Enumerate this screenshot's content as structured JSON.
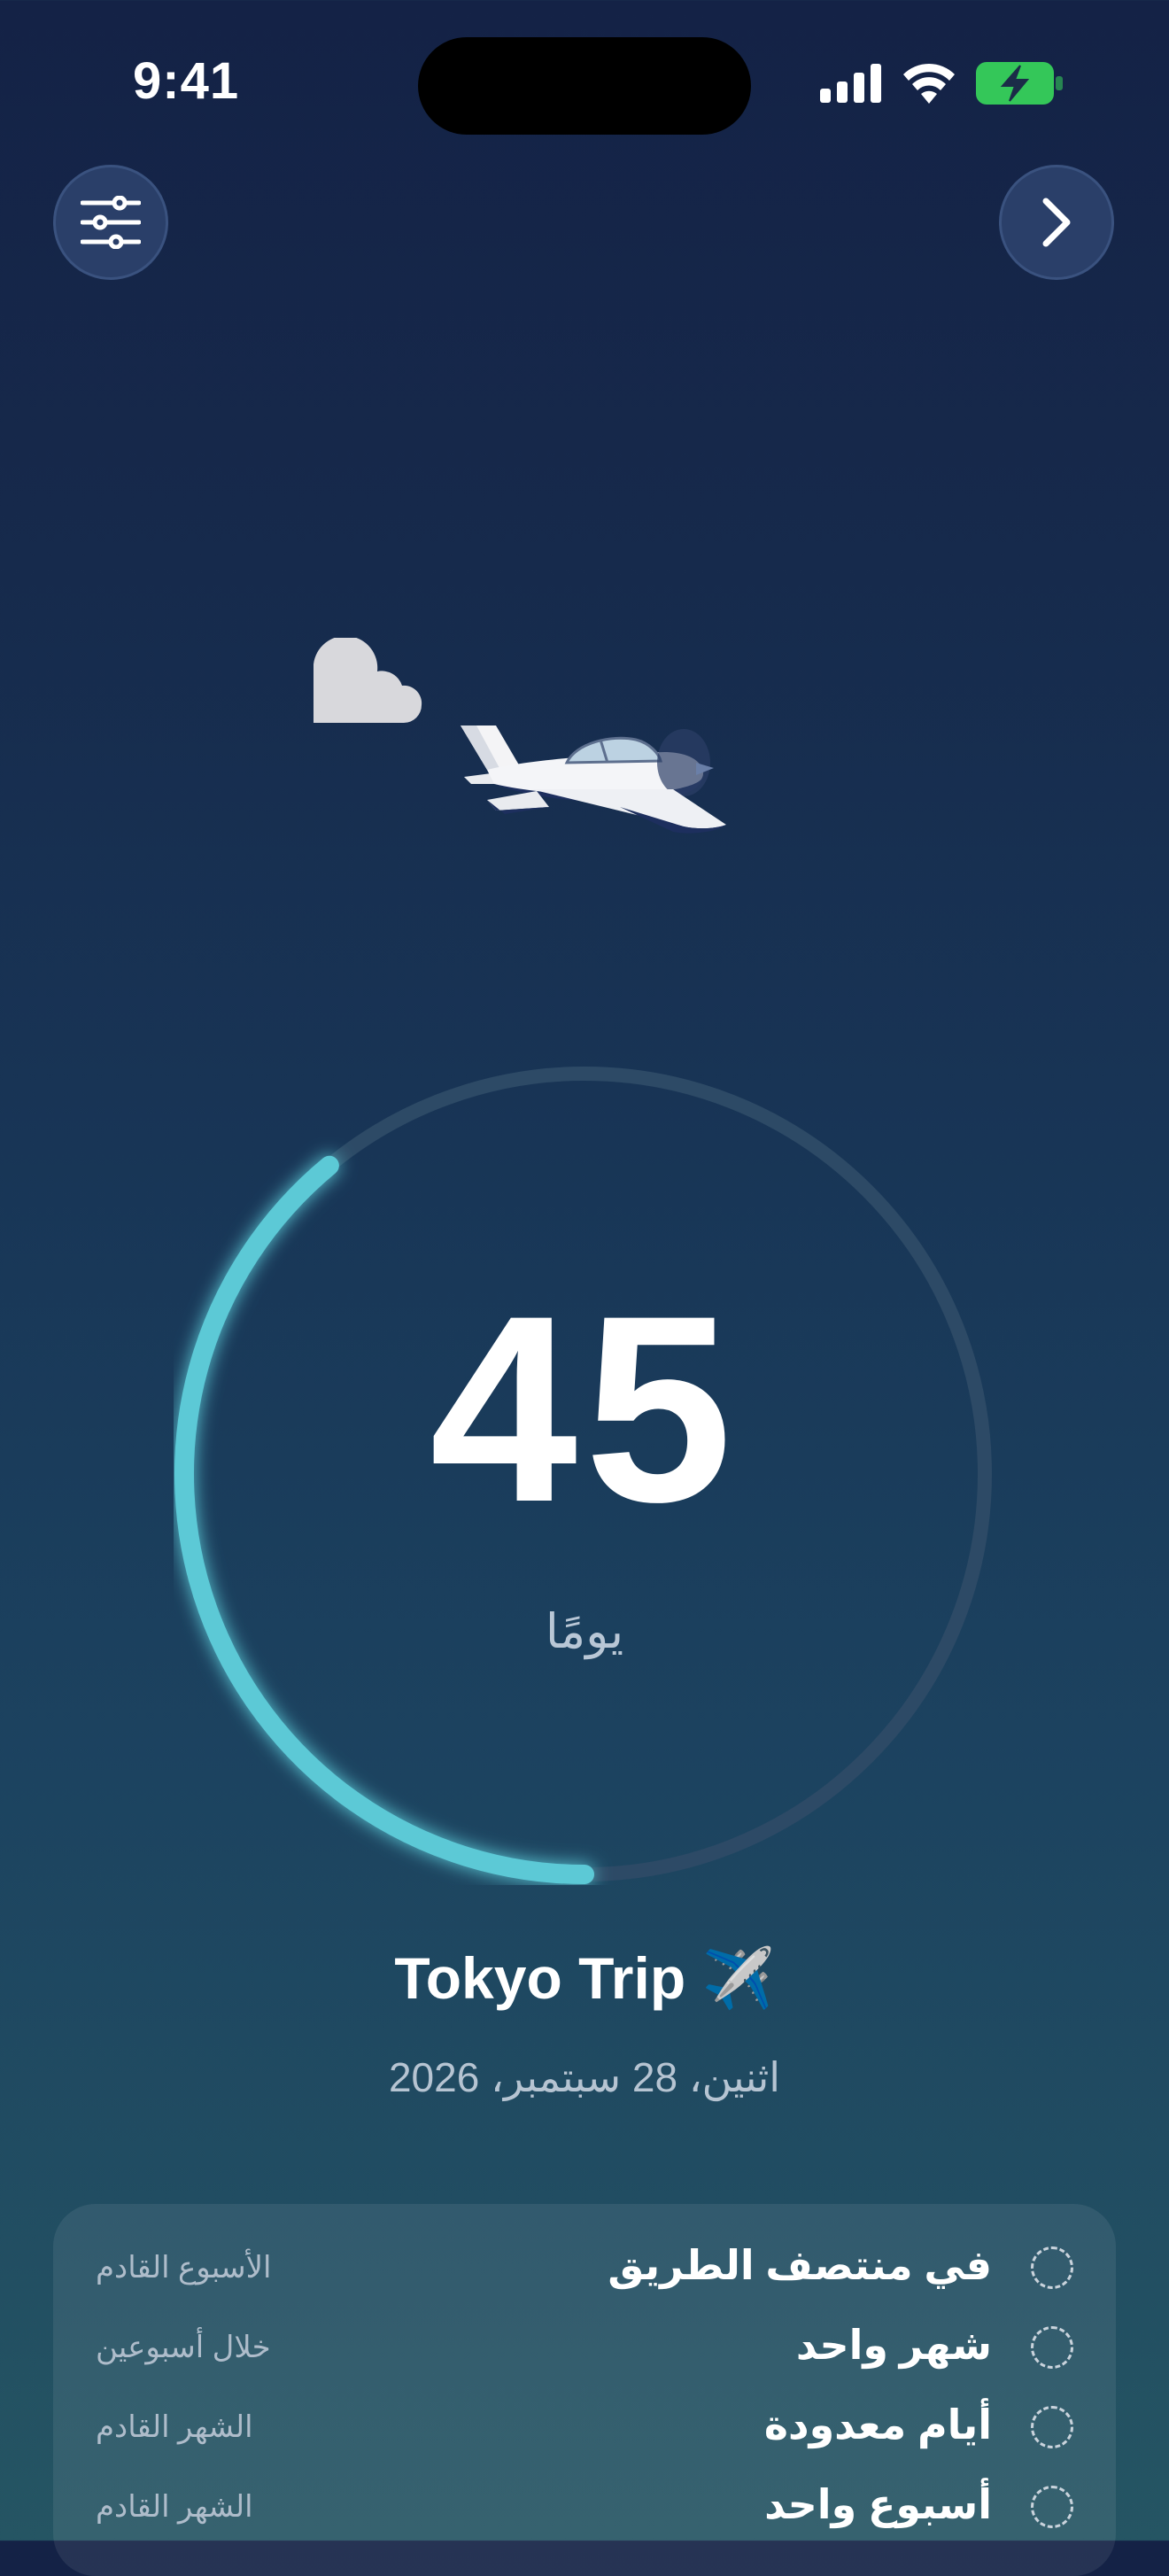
{
  "status_bar": {
    "time": "9:41",
    "battery_color": "#34c759"
  },
  "header": {
    "settings_icon": "sliders-icon",
    "next_icon": "chevron-right-icon"
  },
  "countdown": {
    "value": "45",
    "unit": "يومًا",
    "progress_fraction": 0.39,
    "progress_color": "#5cc9d6"
  },
  "event": {
    "title": "Tokyo Trip ✈️",
    "date": "اثنين، 28 سبتمبر، 2026"
  },
  "milestones": [
    {
      "label": "في منتصف الطريق",
      "when": "الأسبوع القادم"
    },
    {
      "label": "شهر واحد",
      "when": "خلال أسبوعين"
    },
    {
      "label": "أيام معدودة",
      "when": "الشهر القادم"
    },
    {
      "label": "أسبوع واحد",
      "when": "الشهر القادم"
    }
  ]
}
